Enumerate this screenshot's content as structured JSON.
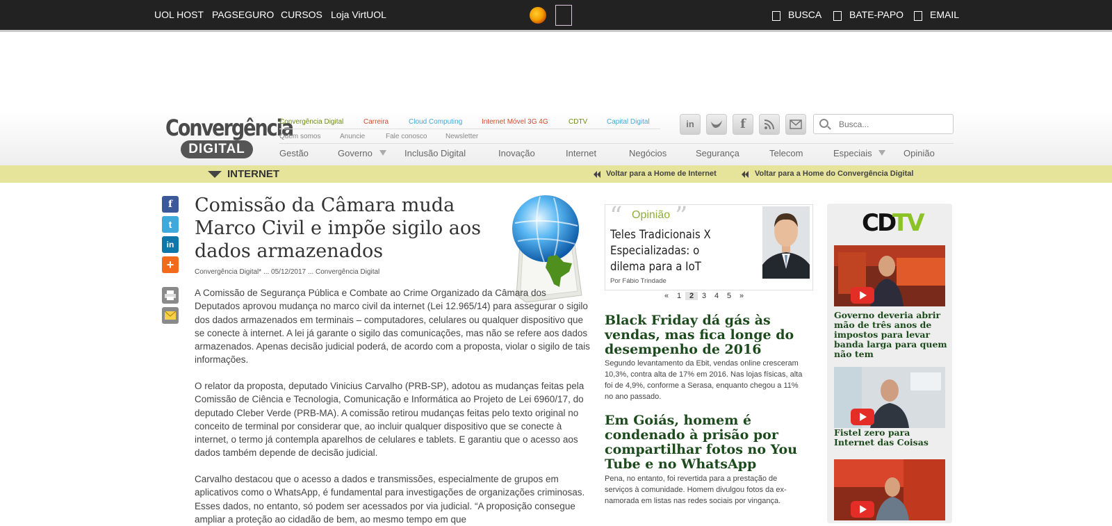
{
  "topbar": {
    "links": [
      "UOL HOST",
      "PAGSEGURO",
      "CURSOS",
      "Loja VirtUOL"
    ],
    "right": [
      "BUSCA",
      "BATE-PAPO",
      "EMAIL"
    ]
  },
  "logo": {
    "line1": "Convergência",
    "line2": "DIGITAL"
  },
  "sections": [
    {
      "label": "Convergência Digital",
      "color": "#6e8c12"
    },
    {
      "label": "Carreira",
      "color": "#d04a2c"
    },
    {
      "label": "Cloud Computing",
      "color": "#44a9d6"
    },
    {
      "label": "Internet Móvel 3G 4G",
      "color": "#d04a2c"
    },
    {
      "label": "CDTV",
      "color": "#6e8c12"
    },
    {
      "label": "Capital Digital",
      "color": "#44a9d6"
    }
  ],
  "institutional": [
    "Quem somos",
    "Anuncie",
    "Fale conosco",
    "Newsletter"
  ],
  "social_icons": [
    "linkedin-icon",
    "twitter-icon",
    "facebook-icon",
    "rss-icon",
    "mail-icon"
  ],
  "search": {
    "placeholder": "Busca..."
  },
  "mainnav": [
    "Gestão",
    "Governo",
    "Inclusão Digital",
    "Inovação",
    "Internet",
    "Negócios",
    "Segurança",
    "Telecom",
    "Especiais",
    "Opinião"
  ],
  "section_bar": {
    "title": "INTERNET",
    "back_section": "Voltar para a Home de Internet",
    "back_home": "Voltar para a Home do Convergência Digital"
  },
  "share_icons": [
    "facebook-icon",
    "twitter-icon",
    "linkedin-icon",
    "add-icon",
    "print-icon",
    "email-icon"
  ],
  "article": {
    "title": "Comissão da Câmara muda Marco Civil e impõe sigilo aos dados armazenados",
    "meta": "Convergência Digital* ... 05/12/2017 ... Convergência Digital",
    "paragraphs": [
      "A Comissão de Segurança Pública e Combate ao Crime Organizado da Câmara dos Deputados aprovou mudança no marco civil da internet (Lei 12.965/14) para assegurar o sigilo dos dados armazenados em terminais – computadores, celulares ou qualquer dispositivo que se conecte à internet. A lei já garante o sigilo das comunicações, mas não se refere aos dados armazenados. Apenas decisão judicial poderá, de acordo com a proposta, violar o sigilo de tais informações.",
      "O relator da proposta, deputado Vinicius Carvalho (PRB-SP), adotou as mudanças feitas pela Comissão de Ciência e Tecnologia, Comunicação e Informática ao Projeto de Lei 6960/17, do deputado Cleber Verde (PRB-MA). A comissão retirou mudanças feitas pelo texto original no conceito de terminal por considerar que, ao incluir qualquer dispositivo que se conecte à internet, o termo já contempla aparelhos de celulares e tablets. E garantiu que o acesso aos dados também depende de decisão judicial.",
      "Carvalho destacou que o acesso a dados e transmissões, especialmente de grupos em aplicativos como o WhatsApp, é fundamental para investigações de organizações criminosas. Esses dados, no entanto, só podem ser acessados por via judicial. “A proposição consegue ampliar a proteção ao cidadão de bem, ao mesmo tempo em que"
    ]
  },
  "opinion": {
    "label": "Opinião",
    "title": "Teles Tradicionais X Especializadas: o dilema para a IoT",
    "byline": "Por Fábio Trindade",
    "pager": [
      "«",
      "1",
      "2",
      "3",
      "4",
      "5",
      "»"
    ],
    "current_page": "2"
  },
  "news": [
    {
      "title": "Black Friday dá gás às vendas, mas fica longe do desempenho de 2016",
      "summary": "Segundo levantamento da Ebit, vendas online cresceram 10,3%, contra alta de 17% em 2016. Nas lojas físicas, alta foi de 4,9%, conforme a Serasa, enquanto chegou a 11% no ano passado."
    },
    {
      "title": "Em Goiás, homem é condenado à prisão por compartilhar fotos no You Tube e no WhatsApp",
      "summary": "Pena, no entanto, foi revertida para a prestação de serviços à comunidade. Homem divulgou fotos da ex-namorada em listas nas redes sociais por vingança."
    }
  ],
  "cdtv": {
    "logo_cd": "CD",
    "logo_tv": "TV",
    "videos": [
      {
        "caption": "Governo deveria abrir mão de três anos de impostos para levar banda larga para quem não tem"
      },
      {
        "caption": "Fistel zero para Internet das Coisas"
      },
      {
        "caption": ""
      }
    ]
  }
}
